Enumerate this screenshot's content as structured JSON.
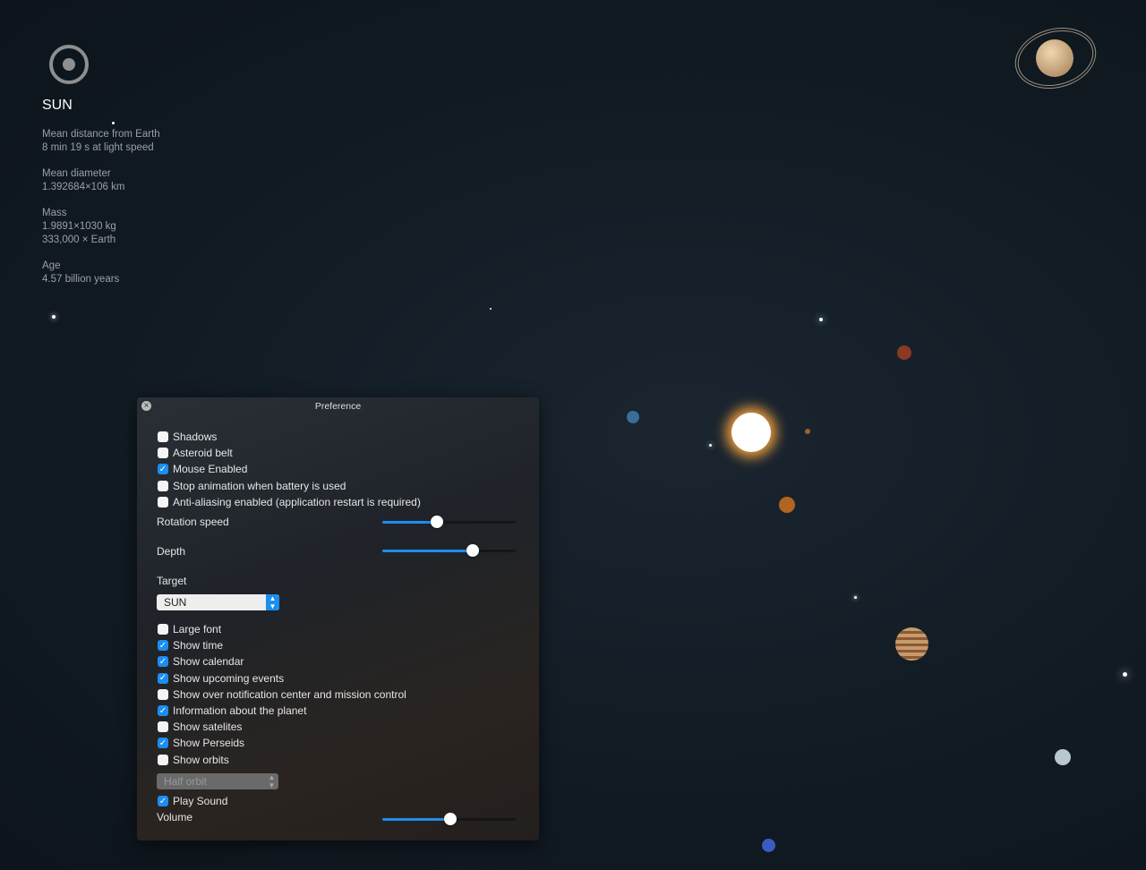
{
  "info": {
    "title": "SUN",
    "blocks": [
      {
        "label": "Mean distance from Earth",
        "lines": [
          "8 min 19 s at light speed"
        ]
      },
      {
        "label": "Mean diameter",
        "lines": [
          "1.392684×106 km"
        ]
      },
      {
        "label": "Mass",
        "lines": [
          "1.9891×1030 kg",
          "333,000 × Earth"
        ]
      },
      {
        "label": "Age",
        "lines": [
          "4.57 billion years"
        ]
      }
    ]
  },
  "panel": {
    "title": "Preference",
    "checks1": [
      {
        "label": "Shadows",
        "checked": false
      },
      {
        "label": "Asteroid belt",
        "checked": false
      },
      {
        "label": "Mouse Enabled",
        "checked": true
      },
      {
        "label": "Stop animation when battery is used",
        "checked": false
      },
      {
        "label": "Anti-aliasing enabled (application restart is required)",
        "checked": false
      }
    ],
    "rotation_label": "Rotation speed",
    "rotation_value": 0.41,
    "depth_label": "Depth",
    "depth_value": 0.68,
    "target_label": "Target",
    "target_value": "SUN",
    "checks2": [
      {
        "label": "Large font",
        "checked": false
      },
      {
        "label": "Show time",
        "checked": true
      },
      {
        "label": "Show calendar",
        "checked": true
      },
      {
        "label": "Show upcoming events",
        "checked": true
      },
      {
        "label": "Show over notification center and mission control",
        "checked": false
      },
      {
        "label": "Information about the planet",
        "checked": true
      },
      {
        "label": "Show satelites",
        "checked": false
      },
      {
        "label": "Show Perseids",
        "checked": true
      },
      {
        "label": "Show orbits",
        "checked": false
      }
    ],
    "orbit_value": "Half orbit",
    "play_sound": {
      "label": "Play Sound",
      "checked": true
    },
    "volume_label": "Volume",
    "volume_value": 0.51
  },
  "colors": {
    "accent": "#1b8ef0"
  }
}
